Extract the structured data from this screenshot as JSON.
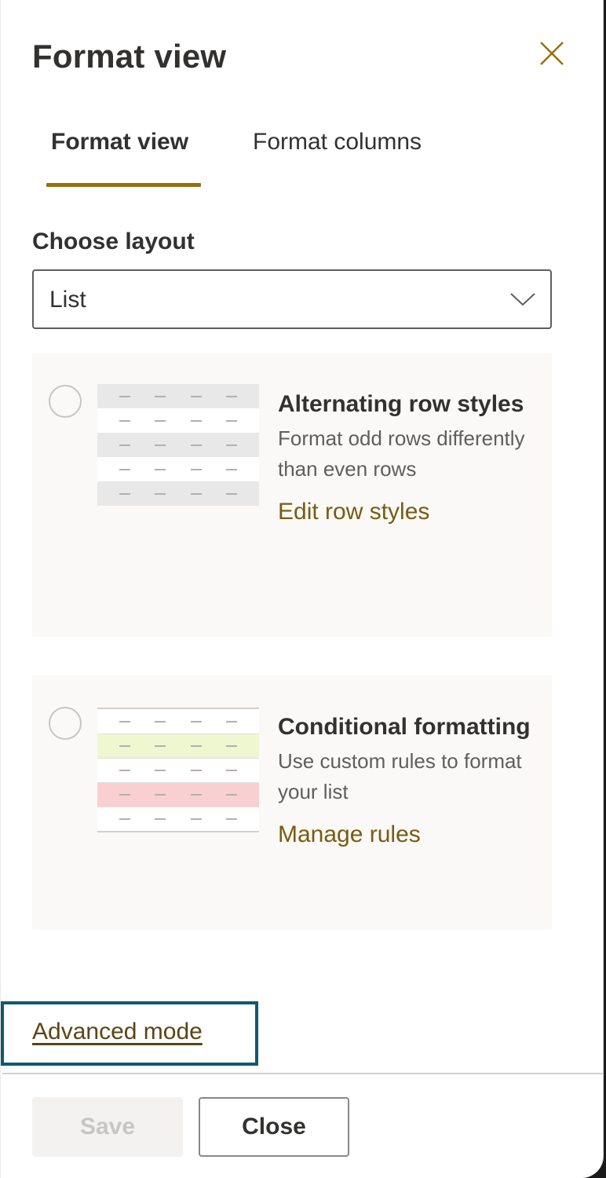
{
  "header": {
    "title": "Format view",
    "close_icon": "close-icon"
  },
  "tabs": [
    {
      "label": "Format view",
      "selected": true
    },
    {
      "label": "Format columns",
      "selected": false
    }
  ],
  "layout": {
    "label": "Choose layout",
    "selected_value": "List",
    "chevron_icon": "chevron-down-icon"
  },
  "cards": [
    {
      "title": "Alternating row styles",
      "description": "Format odd rows differently than even rows",
      "link": "Edit row styles",
      "selected": false,
      "thumbnail_rows": [
        "#e8e8e8",
        "#ffffff",
        "#e8e8e8",
        "#ffffff",
        "#e8e8e8"
      ]
    },
    {
      "title": "Conditional formatting",
      "description": "Use custom rules to format your list",
      "link": "Manage rules",
      "selected": false,
      "thumbnail_rows": [
        "#ffffff",
        "#eff7d0",
        "#ffffff",
        "#f9cfd2",
        "#ffffff"
      ]
    }
  ],
  "advanced_mode_link": "Advanced mode",
  "footer": {
    "save_label": "Save",
    "save_disabled": true,
    "close_label": "Close"
  },
  "colors": {
    "accent": "#986f0b",
    "link": "#7a5c10",
    "focus_outline": "#0c5a72"
  }
}
